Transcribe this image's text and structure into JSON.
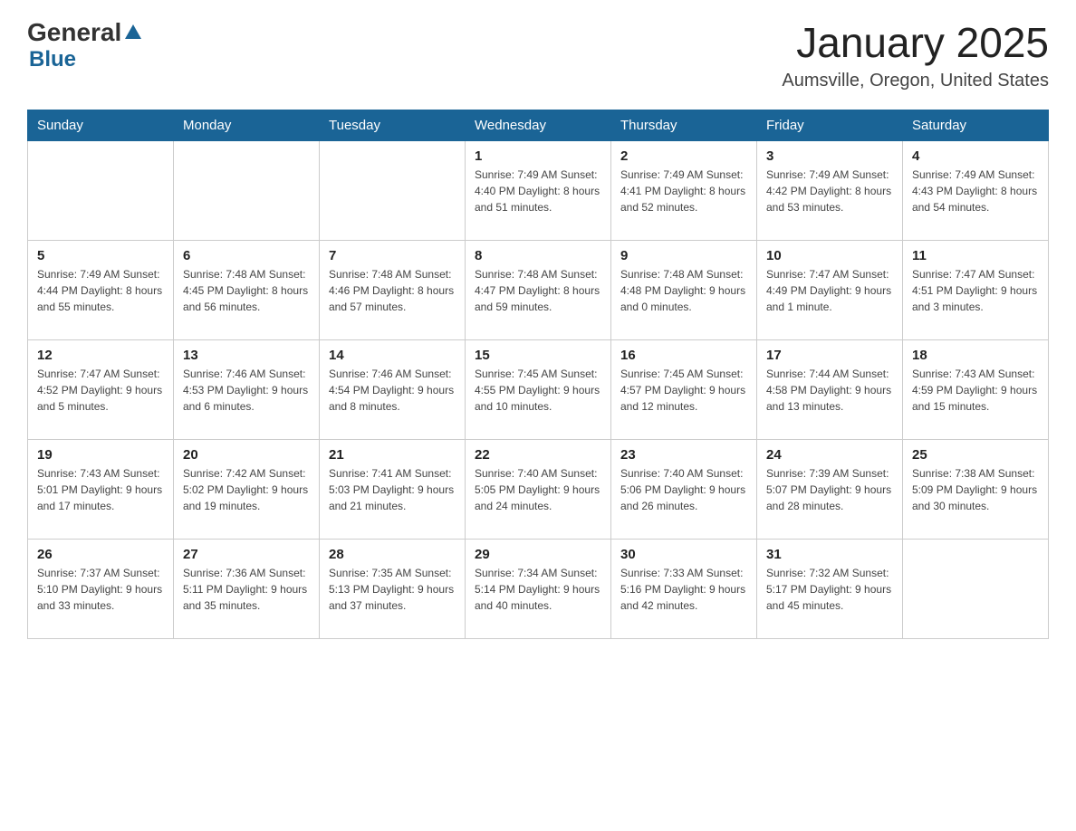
{
  "header": {
    "logo_general": "General",
    "logo_blue": "Blue",
    "title": "January 2025",
    "subtitle": "Aumsville, Oregon, United States"
  },
  "calendar": {
    "days_of_week": [
      "Sunday",
      "Monday",
      "Tuesday",
      "Wednesday",
      "Thursday",
      "Friday",
      "Saturday"
    ],
    "weeks": [
      [
        {
          "day": "",
          "info": ""
        },
        {
          "day": "",
          "info": ""
        },
        {
          "day": "",
          "info": ""
        },
        {
          "day": "1",
          "info": "Sunrise: 7:49 AM\nSunset: 4:40 PM\nDaylight: 8 hours\nand 51 minutes."
        },
        {
          "day": "2",
          "info": "Sunrise: 7:49 AM\nSunset: 4:41 PM\nDaylight: 8 hours\nand 52 minutes."
        },
        {
          "day": "3",
          "info": "Sunrise: 7:49 AM\nSunset: 4:42 PM\nDaylight: 8 hours\nand 53 minutes."
        },
        {
          "day": "4",
          "info": "Sunrise: 7:49 AM\nSunset: 4:43 PM\nDaylight: 8 hours\nand 54 minutes."
        }
      ],
      [
        {
          "day": "5",
          "info": "Sunrise: 7:49 AM\nSunset: 4:44 PM\nDaylight: 8 hours\nand 55 minutes."
        },
        {
          "day": "6",
          "info": "Sunrise: 7:48 AM\nSunset: 4:45 PM\nDaylight: 8 hours\nand 56 minutes."
        },
        {
          "day": "7",
          "info": "Sunrise: 7:48 AM\nSunset: 4:46 PM\nDaylight: 8 hours\nand 57 minutes."
        },
        {
          "day": "8",
          "info": "Sunrise: 7:48 AM\nSunset: 4:47 PM\nDaylight: 8 hours\nand 59 minutes."
        },
        {
          "day": "9",
          "info": "Sunrise: 7:48 AM\nSunset: 4:48 PM\nDaylight: 9 hours\nand 0 minutes."
        },
        {
          "day": "10",
          "info": "Sunrise: 7:47 AM\nSunset: 4:49 PM\nDaylight: 9 hours\nand 1 minute."
        },
        {
          "day": "11",
          "info": "Sunrise: 7:47 AM\nSunset: 4:51 PM\nDaylight: 9 hours\nand 3 minutes."
        }
      ],
      [
        {
          "day": "12",
          "info": "Sunrise: 7:47 AM\nSunset: 4:52 PM\nDaylight: 9 hours\nand 5 minutes."
        },
        {
          "day": "13",
          "info": "Sunrise: 7:46 AM\nSunset: 4:53 PM\nDaylight: 9 hours\nand 6 minutes."
        },
        {
          "day": "14",
          "info": "Sunrise: 7:46 AM\nSunset: 4:54 PM\nDaylight: 9 hours\nand 8 minutes."
        },
        {
          "day": "15",
          "info": "Sunrise: 7:45 AM\nSunset: 4:55 PM\nDaylight: 9 hours\nand 10 minutes."
        },
        {
          "day": "16",
          "info": "Sunrise: 7:45 AM\nSunset: 4:57 PM\nDaylight: 9 hours\nand 12 minutes."
        },
        {
          "day": "17",
          "info": "Sunrise: 7:44 AM\nSunset: 4:58 PM\nDaylight: 9 hours\nand 13 minutes."
        },
        {
          "day": "18",
          "info": "Sunrise: 7:43 AM\nSunset: 4:59 PM\nDaylight: 9 hours\nand 15 minutes."
        }
      ],
      [
        {
          "day": "19",
          "info": "Sunrise: 7:43 AM\nSunset: 5:01 PM\nDaylight: 9 hours\nand 17 minutes."
        },
        {
          "day": "20",
          "info": "Sunrise: 7:42 AM\nSunset: 5:02 PM\nDaylight: 9 hours\nand 19 minutes."
        },
        {
          "day": "21",
          "info": "Sunrise: 7:41 AM\nSunset: 5:03 PM\nDaylight: 9 hours\nand 21 minutes."
        },
        {
          "day": "22",
          "info": "Sunrise: 7:40 AM\nSunset: 5:05 PM\nDaylight: 9 hours\nand 24 minutes."
        },
        {
          "day": "23",
          "info": "Sunrise: 7:40 AM\nSunset: 5:06 PM\nDaylight: 9 hours\nand 26 minutes."
        },
        {
          "day": "24",
          "info": "Sunrise: 7:39 AM\nSunset: 5:07 PM\nDaylight: 9 hours\nand 28 minutes."
        },
        {
          "day": "25",
          "info": "Sunrise: 7:38 AM\nSunset: 5:09 PM\nDaylight: 9 hours\nand 30 minutes."
        }
      ],
      [
        {
          "day": "26",
          "info": "Sunrise: 7:37 AM\nSunset: 5:10 PM\nDaylight: 9 hours\nand 33 minutes."
        },
        {
          "day": "27",
          "info": "Sunrise: 7:36 AM\nSunset: 5:11 PM\nDaylight: 9 hours\nand 35 minutes."
        },
        {
          "day": "28",
          "info": "Sunrise: 7:35 AM\nSunset: 5:13 PM\nDaylight: 9 hours\nand 37 minutes."
        },
        {
          "day": "29",
          "info": "Sunrise: 7:34 AM\nSunset: 5:14 PM\nDaylight: 9 hours\nand 40 minutes."
        },
        {
          "day": "30",
          "info": "Sunrise: 7:33 AM\nSunset: 5:16 PM\nDaylight: 9 hours\nand 42 minutes."
        },
        {
          "day": "31",
          "info": "Sunrise: 7:32 AM\nSunset: 5:17 PM\nDaylight: 9 hours\nand 45 minutes."
        },
        {
          "day": "",
          "info": ""
        }
      ]
    ]
  }
}
